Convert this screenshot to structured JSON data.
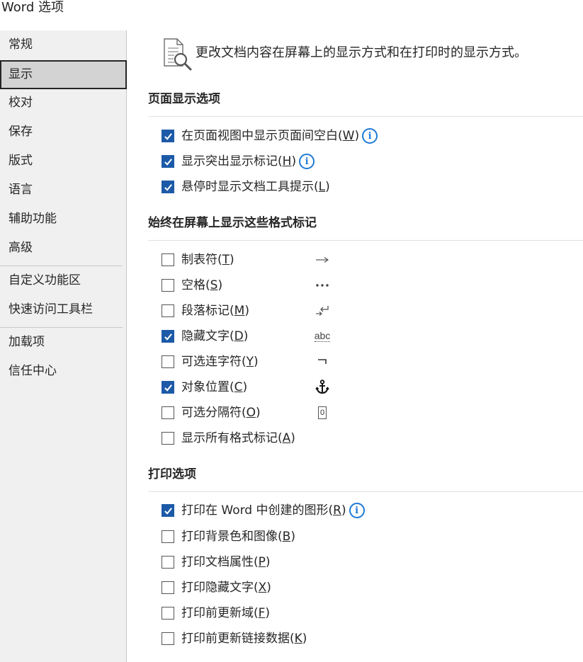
{
  "window": {
    "title": "Word 选项"
  },
  "sidebar": {
    "items": [
      {
        "label": "常规"
      },
      {
        "label": "显示",
        "selected": true
      },
      {
        "label": "校对"
      },
      {
        "label": "保存"
      },
      {
        "label": "版式"
      },
      {
        "label": "语言"
      },
      {
        "label": "辅助功能"
      },
      {
        "label": "高级"
      },
      {
        "label": "自定义功能区"
      },
      {
        "label": "快速访问工具栏"
      },
      {
        "label": "加载项"
      },
      {
        "label": "信任中心"
      }
    ]
  },
  "main": {
    "intro": {
      "text": "更改文档内容在屏幕上的显示方式和在打印时的显示方式。",
      "icon": "document-magnifier-icon"
    },
    "page_display": {
      "header": "页面显示选项",
      "options": [
        {
          "text": "在页面视图中显示页面间空白(",
          "key": "W",
          "suffix": ")",
          "checked": true,
          "info": true
        },
        {
          "text": "显示突出显示标记(",
          "key": "H",
          "suffix": ")",
          "checked": true,
          "info": true
        },
        {
          "text": "悬停时显示文档工具提示(",
          "key": "L",
          "suffix": ")",
          "checked": true
        }
      ]
    },
    "formatting_marks": {
      "header": "始终在屏幕上显示这些格式标记",
      "options": [
        {
          "text": "制表符(",
          "key": "T",
          "suffix": ")",
          "checked": false,
          "symbol": "→",
          "symbol_name": "tab-arrow-icon"
        },
        {
          "text": "空格(",
          "key": "S",
          "suffix": ")",
          "checked": false,
          "symbol": "•••",
          "symbol_name": "space-dots-icon"
        },
        {
          "text": "段落标记(",
          "key": "M",
          "suffix": ")",
          "checked": false,
          "symbol": "↵",
          "symbol_name": "paragraph-mark-icon"
        },
        {
          "text": "隐藏文字(",
          "key": "D",
          "suffix": ")",
          "checked": true,
          "symbol": "abc",
          "symbol_name": "hidden-text-icon"
        },
        {
          "text": "可选连字符(",
          "key": "Y",
          "suffix": ")",
          "checked": false,
          "symbol": "¬",
          "symbol_name": "optional-hyphen-icon"
        },
        {
          "text": "对象位置(",
          "key": "C",
          "suffix": ")",
          "checked": true,
          "symbol": "⚓",
          "symbol_name": "anchor-icon"
        },
        {
          "text": "可选分隔符(",
          "key": "O",
          "suffix": ")",
          "checked": false,
          "symbol": "0",
          "symbol_name": "optional-break-icon"
        },
        {
          "text": "显示所有格式标记(",
          "key": "A",
          "suffix": ")",
          "checked": false
        }
      ]
    },
    "print": {
      "header": "打印选项",
      "options": [
        {
          "text": "打印在 Word 中创建的图形(",
          "key": "R",
          "suffix": ")",
          "checked": true,
          "info": true
        },
        {
          "text": "打印背景色和图像(",
          "key": "B",
          "suffix": ")",
          "checked": false
        },
        {
          "text": "打印文档属性(",
          "key": "P",
          "suffix": ")",
          "checked": false
        },
        {
          "text": "打印隐藏文字(",
          "key": "X",
          "suffix": ")",
          "checked": false
        },
        {
          "text": "打印前更新域(",
          "key": "F",
          "suffix": ")",
          "checked": false
        },
        {
          "text": "打印前更新链接数据(",
          "key": "K",
          "suffix": ")",
          "checked": false
        }
      ]
    }
  },
  "colors": {
    "accent": "#1c5aa8",
    "info": "#1e7ad6",
    "sidebar_bg": "#f0f0f0",
    "selected_bg": "#d3d3d3"
  }
}
